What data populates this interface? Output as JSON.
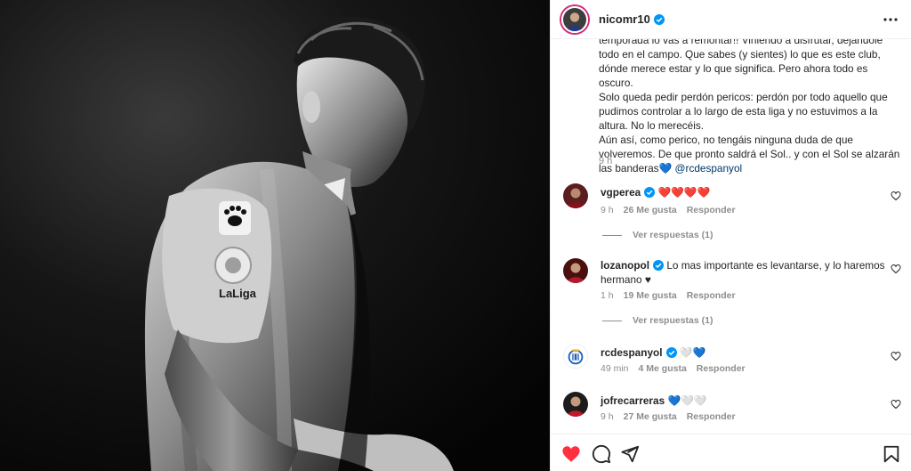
{
  "post": {
    "image_alt": "Black and white photo of a football player with head down, LaLiga patch on sleeve",
    "patch_text": "LaLiga"
  },
  "header": {
    "username": "nicomr10",
    "verified": true
  },
  "caption": {
    "line_partial": "temporada lo vas a remontar!! Viniendo a disfrutar, dejándole",
    "lines": [
      "todo en el campo. Que sabes (y sientes) lo que es este club,",
      "dónde merece estar y lo que significa. Pero ahora todo es oscuro.",
      "Solo queda pedir perdón pericos: perdón por todo aquello que",
      "pudimos controlar a lo largo de esta liga y no estuvimos a la",
      "altura. No lo merecéis.",
      "Aún así, como perico, no tengáis ninguna duda de que",
      "volveremos. De que pronto saldrá el Sol.. y con el Sol se alzarán",
      "las banderas"
    ],
    "emoji": "💙",
    "mention": "@rcdespanyol",
    "time": "9 h"
  },
  "comments": [
    {
      "username": "vgperea",
      "verified": true,
      "text": "❤️❤️❤️❤️",
      "time": "9 h",
      "likes": "26 Me gusta",
      "reply": "Responder",
      "view_replies": "Ver respuestas (1)"
    },
    {
      "username": "lozanopol",
      "verified": true,
      "text": "Lo mas importante es levantarse, y lo haremos hermano ♥",
      "time": "1 h",
      "likes": "19 Me gusta",
      "reply": "Responder",
      "view_replies": "Ver respuestas (1)"
    },
    {
      "username": "rcdespanyol",
      "verified": true,
      "text": "🤍💙",
      "time": "49 min",
      "likes": "4 Me gusta",
      "reply": "Responder"
    },
    {
      "username": "jofrecarreras",
      "verified": false,
      "text": "💙🤍🤍",
      "time": "9 h",
      "likes": "27 Me gusta",
      "reply": "Responder"
    }
  ],
  "icons": {
    "more": "more-horizontal-icon",
    "verified": "verified-badge-icon",
    "like": "heart-icon",
    "liked": "heart-filled-icon",
    "comment": "comment-icon",
    "share": "paper-plane-icon",
    "save": "bookmark-icon"
  },
  "colors": {
    "verified_blue": "#0095f6",
    "like_red": "#ff3040",
    "muted_text": "#8e8e8e",
    "link": "#00376b"
  }
}
